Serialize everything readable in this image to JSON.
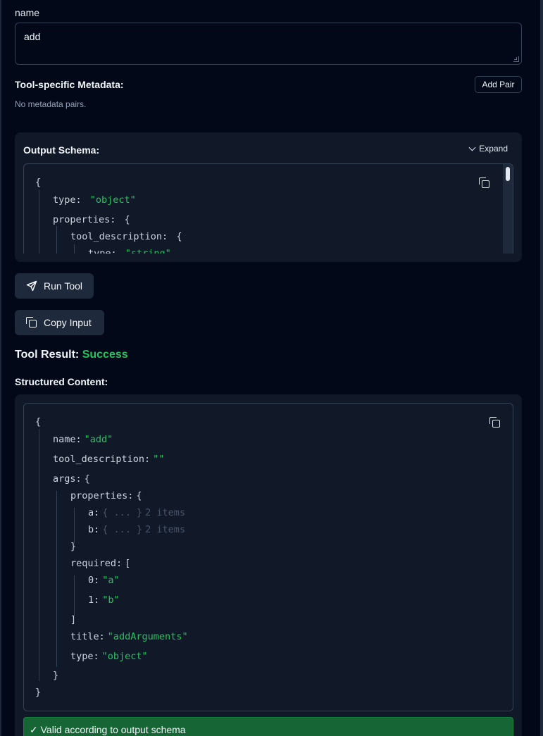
{
  "name_field": {
    "label": "name",
    "value": "add"
  },
  "metadata": {
    "title": "Tool-specific Metadata:",
    "add_pair_label": "Add Pair",
    "empty_text": "No metadata pairs."
  },
  "output_schema": {
    "title": "Output Schema:",
    "expand_label": "Expand",
    "lines": {
      "l0": "{",
      "l1_key": "type:",
      "l1_val": "\"object\"",
      "l2_key": "properties:",
      "l2_open": "{",
      "l3_key": "tool_description:",
      "l3_open": "{",
      "l4_key": "type:",
      "l4_val": "\"string\""
    }
  },
  "actions": {
    "run_label": "Run Tool",
    "copy_input_label": "Copy Input"
  },
  "result": {
    "title": "Tool Result:",
    "status": "Success",
    "colors": {
      "success": "#22c55e"
    }
  },
  "structured": {
    "title": "Structured Content:",
    "lines": {
      "open": "{",
      "name_key": "name:",
      "name_val": "\"add\"",
      "desc_key": "tool_description:",
      "desc_val": "\"\"",
      "args_key": "args:",
      "args_open": "{",
      "props_key": "properties:",
      "props_open": "{",
      "a_key": "a:",
      "a_val": "{ ... }",
      "a_count": "2 items",
      "b_key": "b:",
      "b_val": "{ ... }",
      "b_count": "2 items",
      "props_close": "}",
      "req_key": "required:",
      "req_open": "[",
      "r0_key": "0:",
      "r0_val": "\"a\"",
      "r1_key": "1:",
      "r1_val": "\"b\"",
      "req_close": "]",
      "title_key": "title:",
      "title_val": "\"addArguments\"",
      "type_key": "type:",
      "type_val": "\"object\"",
      "args_close": "}",
      "close": "}"
    },
    "validation": "✓ Valid according to output schema"
  }
}
